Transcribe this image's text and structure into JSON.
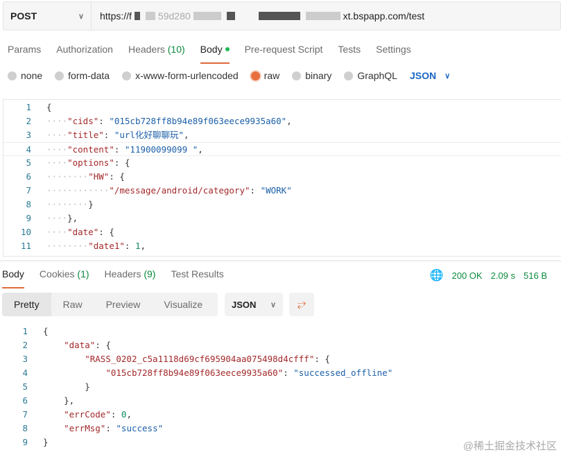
{
  "request": {
    "method": "POST",
    "url_prefix": "https://f",
    "url_fragment": "59d280",
    "url_suffix": "xt.bspapp.com/test"
  },
  "req_tabs": [
    {
      "label": "Params"
    },
    {
      "label": "Authorization"
    },
    {
      "label": "Headers",
      "count": "(10)"
    },
    {
      "label": "Body"
    },
    {
      "label": "Pre-request Script"
    },
    {
      "label": "Tests"
    },
    {
      "label": "Settings"
    }
  ],
  "body_types": [
    "none",
    "form-data",
    "x-www-form-urlencoded",
    "raw",
    "binary",
    "GraphQL"
  ],
  "body_format": "JSON",
  "request_body": [
    [
      [
        "p",
        "{"
      ]
    ],
    [
      [
        "w",
        "····"
      ],
      [
        "k",
        "\"cids\""
      ],
      [
        "p",
        ": "
      ],
      [
        "s",
        "\"015cb728ff8b94e89f063eece9935a60\""
      ],
      [
        "p",
        ","
      ]
    ],
    [
      [
        "w",
        "····"
      ],
      [
        "k",
        "\"title\""
      ],
      [
        "p",
        ": "
      ],
      [
        "s",
        "\"url化好聊聊玩\""
      ],
      [
        "p",
        ","
      ]
    ],
    [
      [
        "w",
        "····"
      ],
      [
        "k",
        "\"content\""
      ],
      [
        "p",
        ": "
      ],
      [
        "s",
        "\"11900099099 \""
      ],
      [
        "p",
        ","
      ]
    ],
    [
      [
        "w",
        "····"
      ],
      [
        "k",
        "\"options\""
      ],
      [
        "p",
        ": {"
      ]
    ],
    [
      [
        "w",
        "········"
      ],
      [
        "k",
        "\"HW\""
      ],
      [
        "p",
        ": {"
      ]
    ],
    [
      [
        "w",
        "············"
      ],
      [
        "k",
        "\"/message/android/category\""
      ],
      [
        "p",
        ": "
      ],
      [
        "s",
        "\"WORK\""
      ]
    ],
    [
      [
        "w",
        "········"
      ],
      [
        "p",
        "}"
      ]
    ],
    [
      [
        "w",
        "····"
      ],
      [
        "p",
        "},"
      ]
    ],
    [
      [
        "w",
        "····"
      ],
      [
        "k",
        "\"date\""
      ],
      [
        "p",
        ": {"
      ]
    ],
    [
      [
        "w",
        "········"
      ],
      [
        "k",
        "\"date1\""
      ],
      [
        "p",
        ": "
      ],
      [
        "n",
        "1"
      ],
      [
        "p",
        ","
      ]
    ]
  ],
  "resp_tabs": [
    {
      "label": "Body"
    },
    {
      "label": "Cookies",
      "count": "(1)"
    },
    {
      "label": "Headers",
      "count": "(9)"
    },
    {
      "label": "Test Results"
    }
  ],
  "status": {
    "code": "200 OK",
    "time": "2.09 s",
    "size": "516 B"
  },
  "view_modes": [
    "Pretty",
    "Raw",
    "Preview",
    "Visualize"
  ],
  "resp_format": "JSON",
  "response_body": [
    [
      [
        "p",
        "{"
      ]
    ],
    [
      [
        "w",
        "    "
      ],
      [
        "k",
        "\"data\""
      ],
      [
        "p",
        ": {"
      ]
    ],
    [
      [
        "w",
        "        "
      ],
      [
        "k",
        "\"RASS_0202_c5a1118d69cf695904aa075498d4cfff\""
      ],
      [
        "p",
        ": {"
      ]
    ],
    [
      [
        "w",
        "            "
      ],
      [
        "k",
        "\"015cb728ff8b94e89f063eece9935a60\""
      ],
      [
        "p",
        ": "
      ],
      [
        "s",
        "\"successed_offline\""
      ]
    ],
    [
      [
        "w",
        "        "
      ],
      [
        "p",
        "}"
      ]
    ],
    [
      [
        "w",
        "    "
      ],
      [
        "p",
        "},"
      ]
    ],
    [
      [
        "w",
        "    "
      ],
      [
        "k",
        "\"errCode\""
      ],
      [
        "p",
        ": "
      ],
      [
        "n",
        "0"
      ],
      [
        "p",
        ","
      ]
    ],
    [
      [
        "w",
        "    "
      ],
      [
        "k",
        "\"errMsg\""
      ],
      [
        "p",
        ": "
      ],
      [
        "s",
        "\"success\""
      ]
    ],
    [
      [
        "p",
        "}"
      ]
    ]
  ],
  "watermark": "@稀土掘金技术社区"
}
